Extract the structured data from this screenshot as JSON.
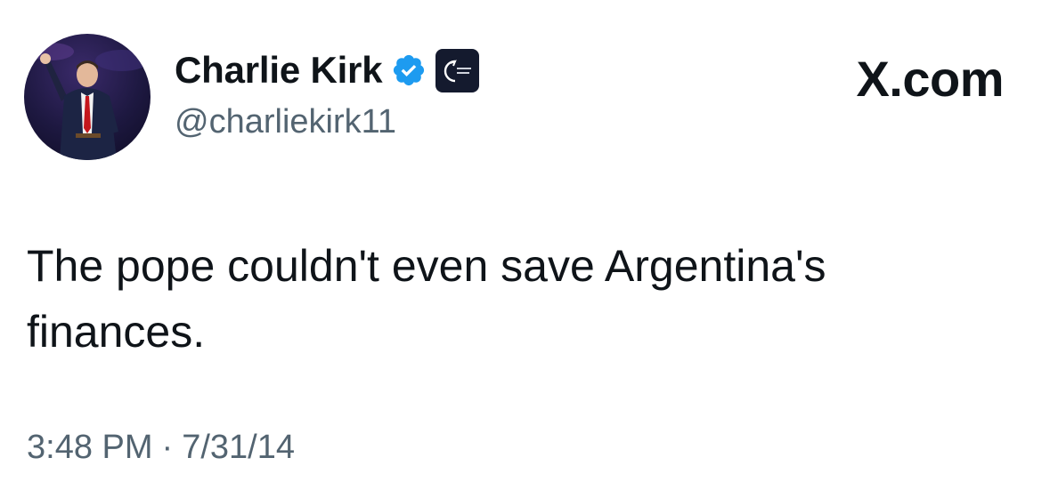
{
  "author": {
    "display_name": "Charlie Kirk",
    "handle": "@charliekirk11",
    "verified_icon": "verified-badge-icon",
    "affiliate_icon": "affiliate-logo-icon",
    "avatar_icon": "profile-photo",
    "verified_color": "#1d9bf0"
  },
  "brand": {
    "label": "X.com"
  },
  "tweet": {
    "text": "The pope couldn't even save Argentina's finances.",
    "time": "3:48 PM",
    "separator": "·",
    "date": "7/31/14"
  }
}
